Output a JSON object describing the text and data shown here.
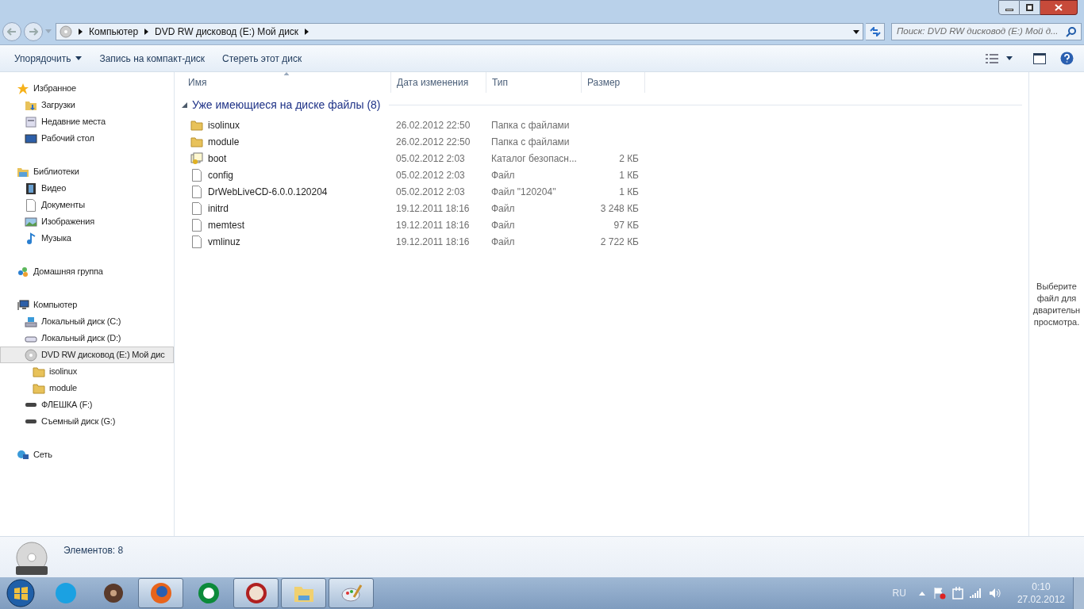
{
  "address_bar": {
    "crumbs": [
      "Компьютер",
      "DVD RW дисковод (E:) Мой диск"
    ]
  },
  "search": {
    "placeholder": "Поиск: DVD RW дисковод (E:) Мой д..."
  },
  "toolbar": {
    "items": [
      {
        "label": "Упорядочить",
        "dropdown": true
      },
      {
        "label": "Запись на компакт-диск",
        "dropdown": false
      },
      {
        "label": "Стереть этот диск",
        "dropdown": false
      }
    ]
  },
  "sidebar": {
    "groups": [
      {
        "label": "Избранное",
        "selected": false,
        "children": [
          {
            "label": "Загрузки",
            "selected": false
          },
          {
            "label": "Недавние места",
            "selected": false
          },
          {
            "label": "Рабочий стол",
            "selected": false
          }
        ]
      },
      {
        "label": "Библиотеки",
        "selected": false,
        "children": [
          {
            "label": "Видео",
            "selected": false
          },
          {
            "label": "Документы",
            "selected": false
          },
          {
            "label": "Изображения",
            "selected": false
          },
          {
            "label": "Музыка",
            "selected": false
          }
        ]
      },
      {
        "label": "Домашняя группа",
        "selected": false
      },
      {
        "label": "Компьютер",
        "selected": false,
        "children": [
          {
            "label": "Локальный диск (C:)",
            "selected": false
          },
          {
            "label": "Локальный диск (D:)",
            "selected": false
          },
          {
            "label": "DVD RW дисковод (E:) Мой дис",
            "selected": true,
            "children": [
              {
                "label": "isolinux",
                "selected": false
              },
              {
                "label": "module",
                "selected": false
              }
            ]
          },
          {
            "label": "ФЛЕШКА (F:)",
            "selected": false
          },
          {
            "label": "Съемный диск (G:)",
            "selected": false
          }
        ]
      },
      {
        "label": "Сеть",
        "selected": false
      }
    ]
  },
  "table": {
    "columns": [
      {
        "label": "Имя",
        "sorted": true
      },
      {
        "label": "Дата изменения",
        "sorted": false
      },
      {
        "label": "Тип",
        "sorted": false
      },
      {
        "label": "Размер",
        "sorted": false
      }
    ],
    "group": {
      "label": "Уже имеющиеся на диске файлы (8)",
      "expanded": true
    },
    "rows": [
      {
        "kind": "folder",
        "name": "isolinux",
        "date": "26.02.2012 22:50",
        "type": "Папка с файлами",
        "size": ""
      },
      {
        "kind": "folder",
        "name": "module",
        "date": "26.02.2012 22:50",
        "type": "Папка с файлами",
        "size": ""
      },
      {
        "kind": "catalog",
        "name": "boot",
        "date": "05.02.2012 2:03",
        "type": "Каталог безопасн...",
        "size": "2 КБ"
      },
      {
        "kind": "file",
        "name": "config",
        "date": "05.02.2012 2:03",
        "type": "Файл",
        "size": "1 КБ"
      },
      {
        "kind": "file",
        "name": "DrWebLiveCD-6.0.0.120204",
        "date": "05.02.2012 2:03",
        "type": "Файл \"120204\"",
        "size": "1 КБ"
      },
      {
        "kind": "file",
        "name": "initrd",
        "date": "19.12.2011 18:16",
        "type": "Файл",
        "size": "3 248 КБ"
      },
      {
        "kind": "file",
        "name": "memtest",
        "date": "19.12.2011 18:16",
        "type": "Файл",
        "size": "97 КБ"
      },
      {
        "kind": "file",
        "name": "vmlinuz",
        "date": "19.12.2011 18:16",
        "type": "Файл",
        "size": "2 722 КБ"
      }
    ]
  },
  "preview_pane": {
    "lines": [
      "Выберите",
      "файл для",
      "дварительн",
      "просмотра."
    ]
  },
  "details_pane": {
    "text": "Элементов: 8"
  },
  "taskbar": {
    "apps": [
      {
        "running": false
      },
      {
        "running": false
      },
      {
        "running": true
      },
      {
        "running": false
      },
      {
        "running": true
      },
      {
        "running": true
      },
      {
        "running": true
      }
    ],
    "language": "RU",
    "time": "0:10",
    "date": "27.02.2012"
  }
}
